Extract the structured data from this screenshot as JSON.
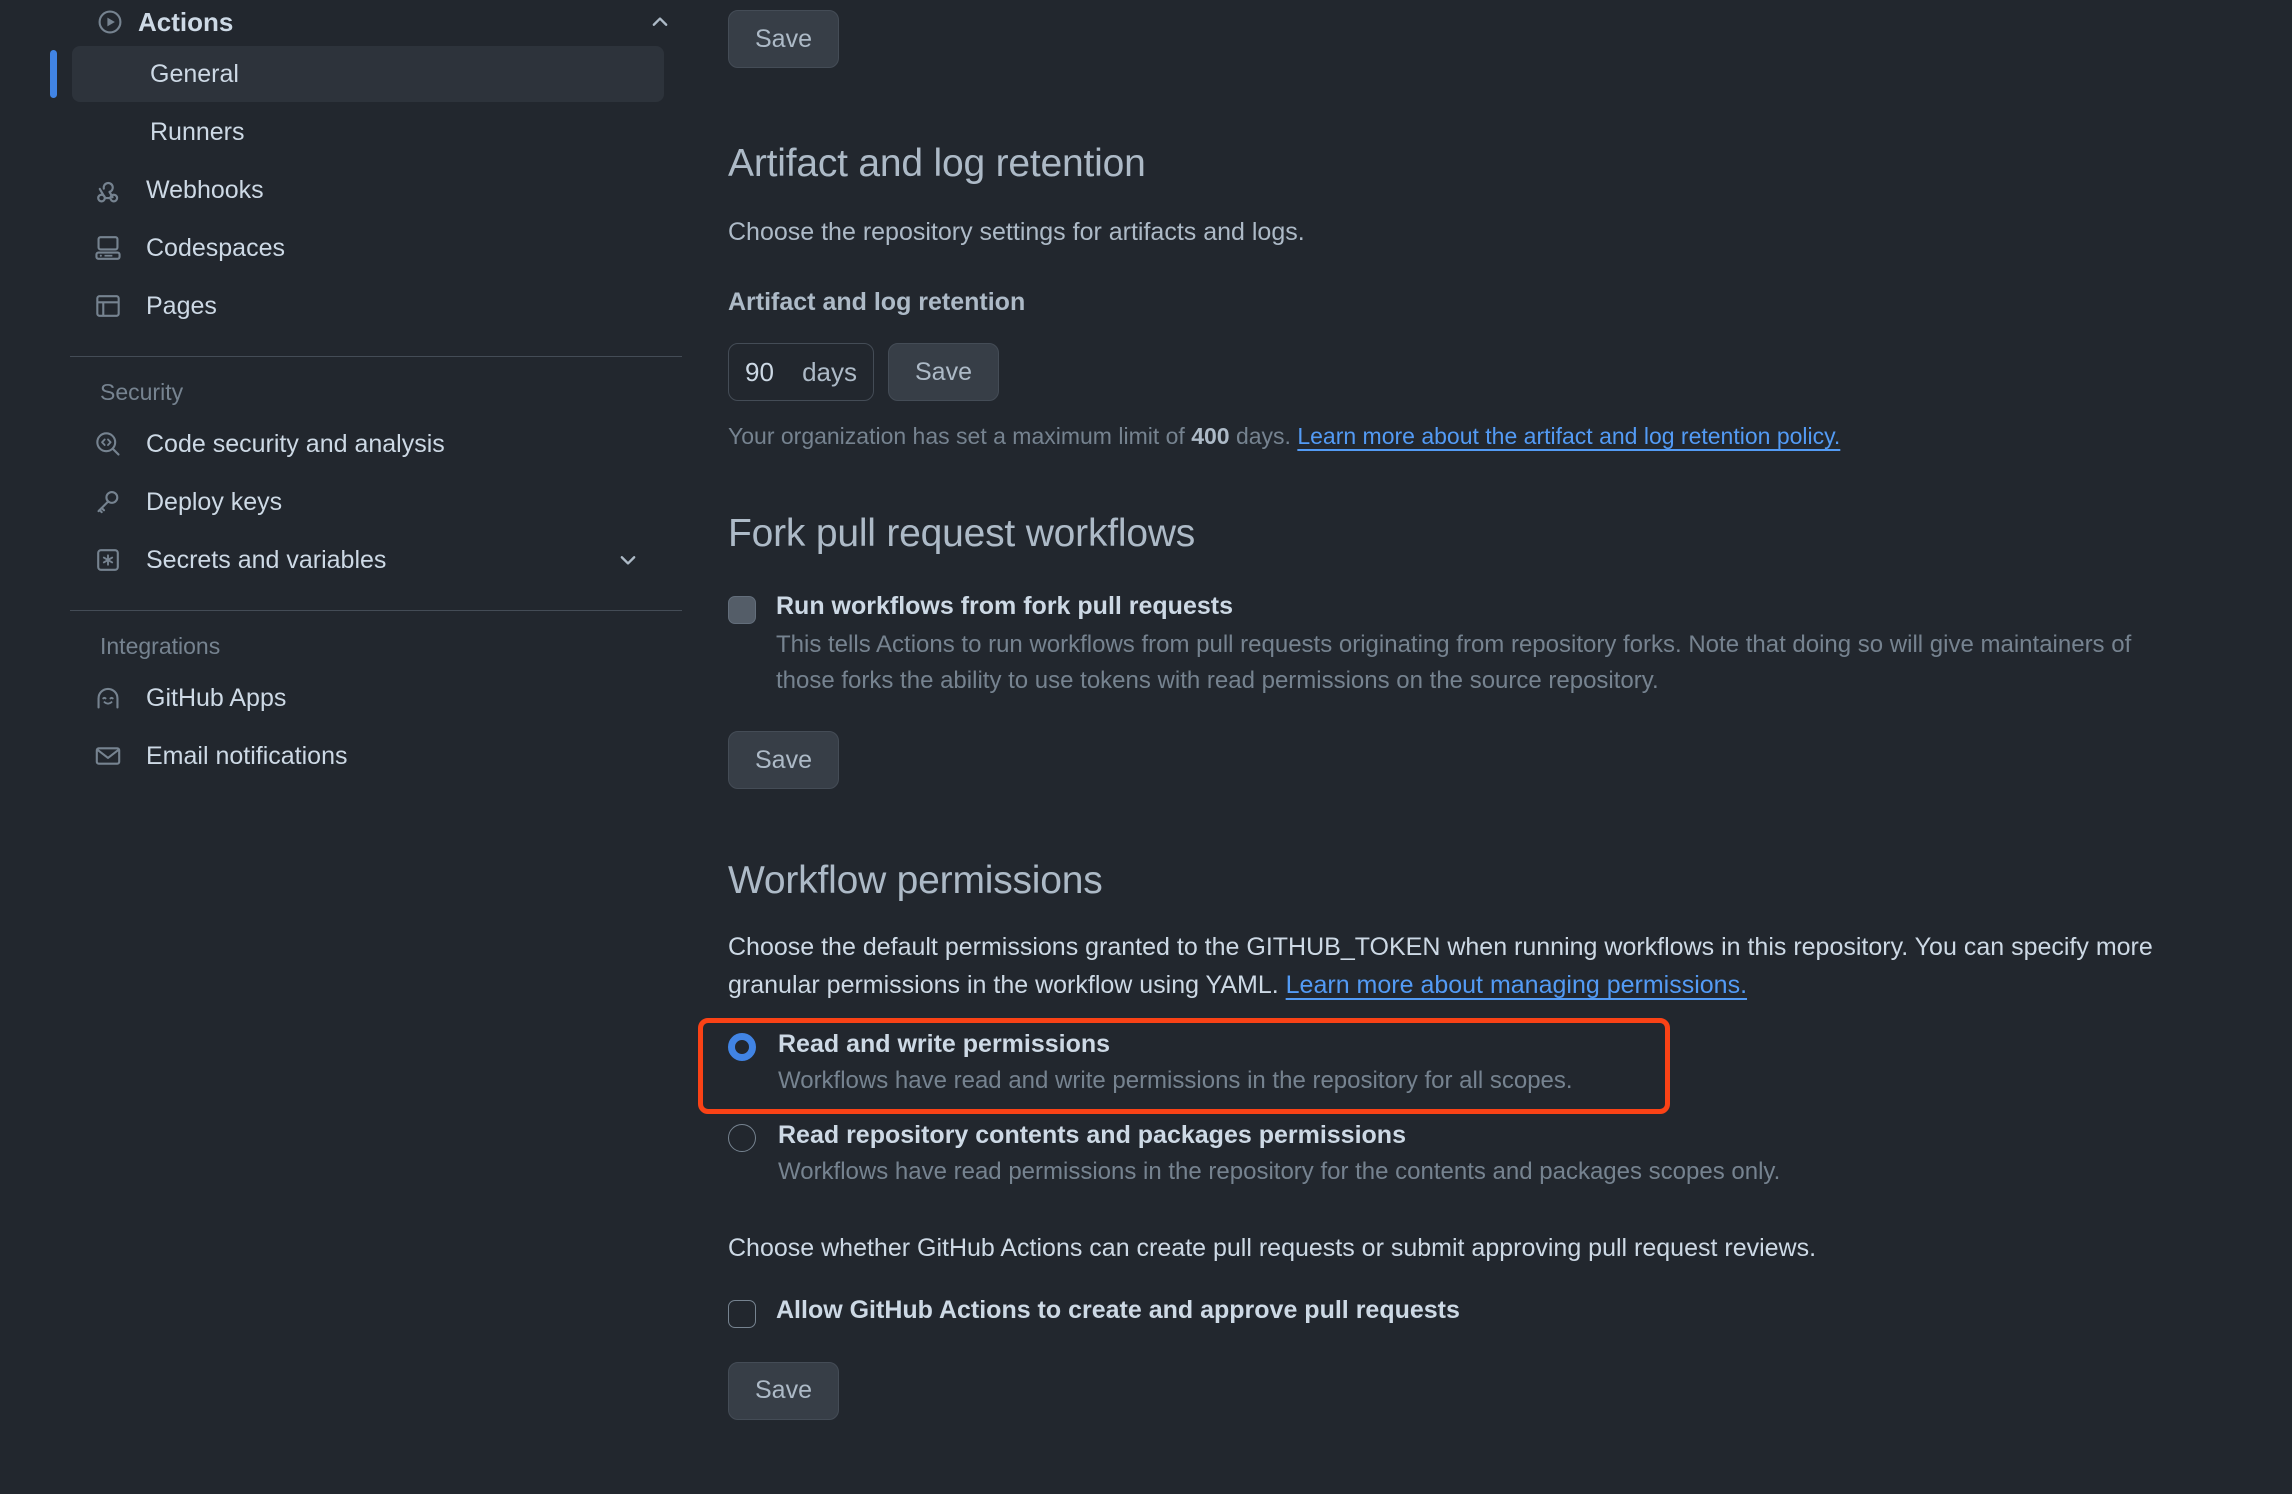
{
  "sidebar": {
    "actions_section": {
      "label": "Actions",
      "icon": "play-circle-icon",
      "chevron": "chevron-up-icon",
      "items": [
        {
          "label": "General",
          "selected": true
        },
        {
          "label": "Runners",
          "selected": false
        }
      ]
    },
    "top_items": [
      {
        "label": "Webhooks",
        "icon": "webhook-icon"
      },
      {
        "label": "Codespaces",
        "icon": "codespaces-icon"
      },
      {
        "label": "Pages",
        "icon": "browser-icon"
      }
    ],
    "groups": [
      {
        "title": "Security",
        "items": [
          {
            "label": "Code security and analysis",
            "icon": "code-scan-icon",
            "chevron": null
          },
          {
            "label": "Deploy keys",
            "icon": "key-icon",
            "chevron": null
          },
          {
            "label": "Secrets and variables",
            "icon": "asterisk-box-icon",
            "chevron": "chevron-down-icon"
          }
        ]
      },
      {
        "title": "Integrations",
        "items": [
          {
            "label": "GitHub Apps",
            "icon": "apps-icon",
            "chevron": null
          },
          {
            "label": "Email notifications",
            "icon": "mail-icon",
            "chevron": null
          }
        ]
      }
    ]
  },
  "main": {
    "top_save_label": "Save",
    "artifact": {
      "heading": "Artifact and log retention",
      "description": "Choose the repository settings for artifacts and logs.",
      "field_label": "Artifact and log retention",
      "value": "90",
      "unit": "days",
      "save_label": "Save",
      "hint_prefix": "Your organization has set a maximum limit of ",
      "hint_limit": "400",
      "hint_suffix": " days. ",
      "hint_link": "Learn more about the artifact and log retention policy."
    },
    "fork": {
      "heading": "Fork pull request workflows",
      "checkbox_label": "Run workflows from fork pull requests",
      "checkbox_desc": "This tells Actions to run workflows from pull requests originating from repository forks. Note that doing so will give maintainers of those forks the ability to use tokens with read permissions on the source repository.",
      "checkbox_state": "disabled",
      "save_label": "Save"
    },
    "permissions": {
      "heading": "Workflow permissions",
      "description_prefix": "Choose the default permissions granted to the GITHUB_TOKEN when running workflows in this repository. You can specify more granular permissions in the workflow using YAML. ",
      "description_link": "Learn more about managing permissions.",
      "options": [
        {
          "label": "Read and write permissions",
          "desc": "Workflows have read and write permissions in the repository for all scopes.",
          "checked": true,
          "highlighted": true
        },
        {
          "label": "Read repository contents and packages permissions",
          "desc": "Workflows have read permissions in the repository for the contents and packages scopes only.",
          "checked": false,
          "highlighted": false
        }
      ],
      "pr_paragraph": "Choose whether GitHub Actions can create pull requests or submit approving pull request reviews.",
      "pr_checkbox_label": "Allow GitHub Actions to create and approve pull requests",
      "pr_checkbox_state": "empty",
      "save_label": "Save"
    }
  },
  "colors": {
    "page_bg": "#22272e",
    "accent_blue": "#4184e4",
    "link_blue": "#539bf5",
    "annotation_red": "#fa4216",
    "selected_nav_bg": "#2d333b"
  }
}
